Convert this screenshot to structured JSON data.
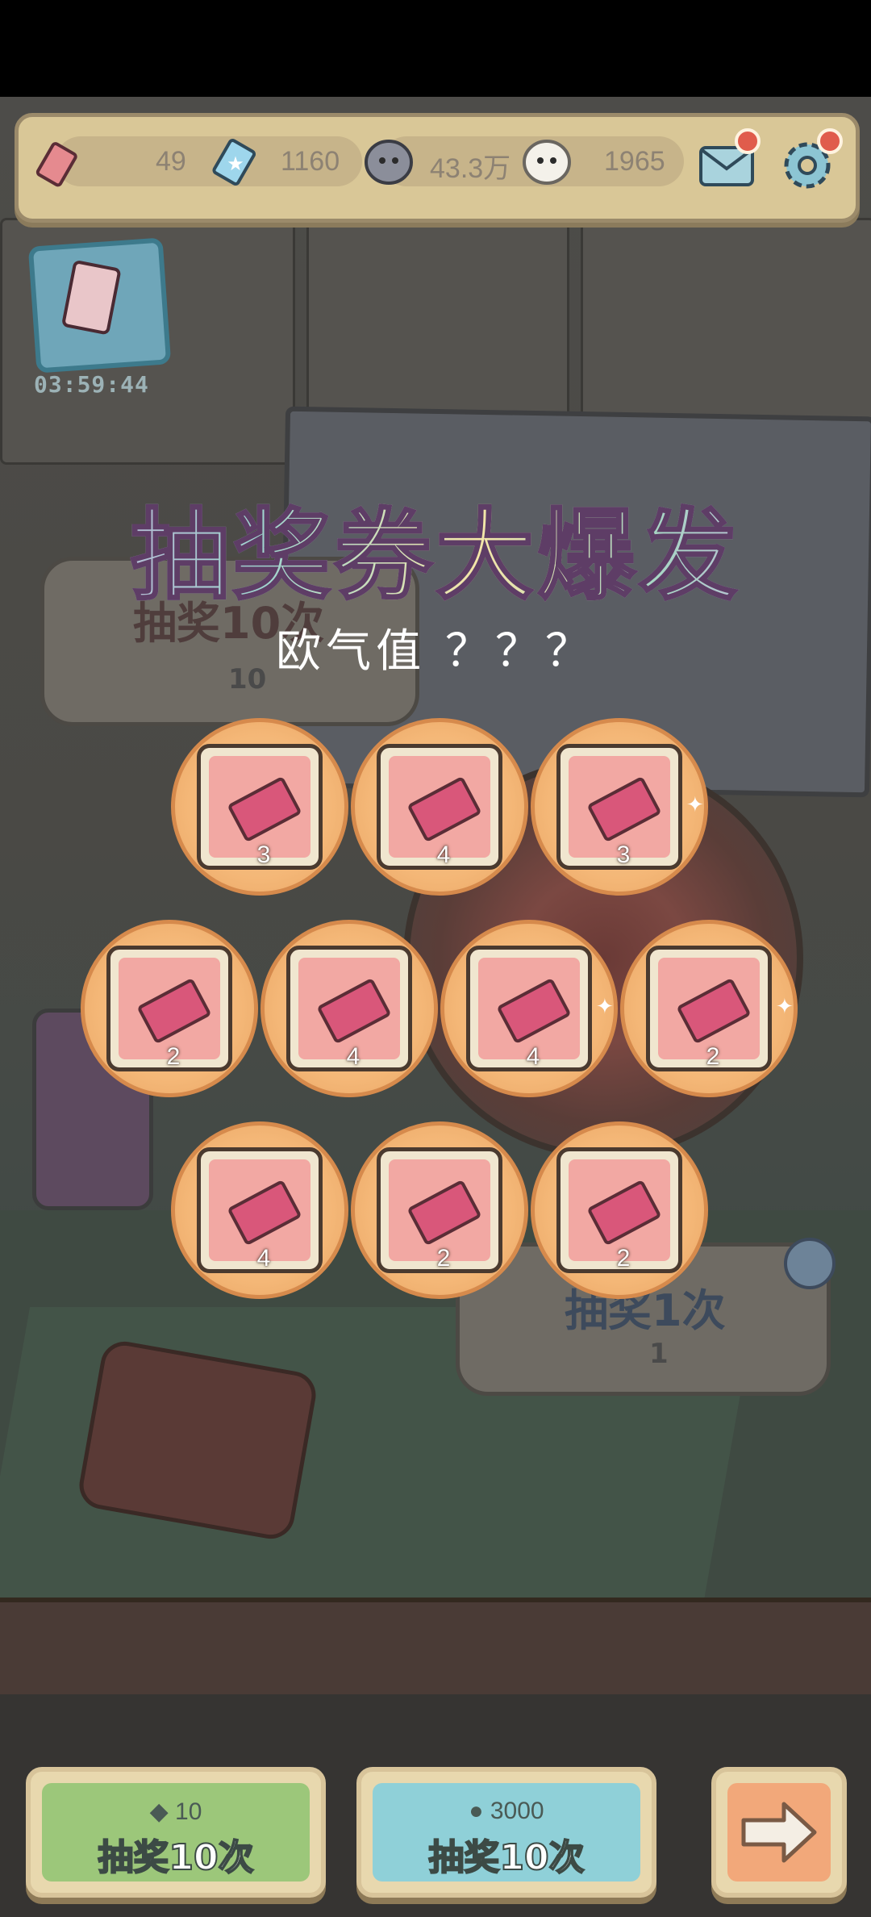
{
  "resources": {
    "tickets": "49",
    "stars": "1160",
    "dark_souls": "43.3万",
    "light_souls": "1965"
  },
  "timer": "03:59:44",
  "signs": {
    "ten_draw_label": "抽奖10次",
    "ten_draw_cost": "10",
    "one_draw_label": "抽奖1次",
    "one_draw_cost": "1"
  },
  "event": {
    "title": "抽奖券大爆发",
    "luck_value": "欧气值 ？？？"
  },
  "rewards": [
    {
      "count": "3"
    },
    {
      "count": "4"
    },
    {
      "count": "3"
    },
    {
      "count": "2"
    },
    {
      "count": "4"
    },
    {
      "count": "4"
    },
    {
      "count": "2"
    },
    {
      "count": "4"
    },
    {
      "count": "2"
    },
    {
      "count": "2"
    }
  ],
  "buttons": {
    "ticket_draw": {
      "cost": "10",
      "label": "抽奖10次"
    },
    "soul_draw": {
      "cost": "3000",
      "label": "抽奖10次"
    }
  },
  "colors": {
    "ticket_button": "#9cc77a",
    "soul_button": "#8fd0d8",
    "next_button": "#f2a87a"
  }
}
